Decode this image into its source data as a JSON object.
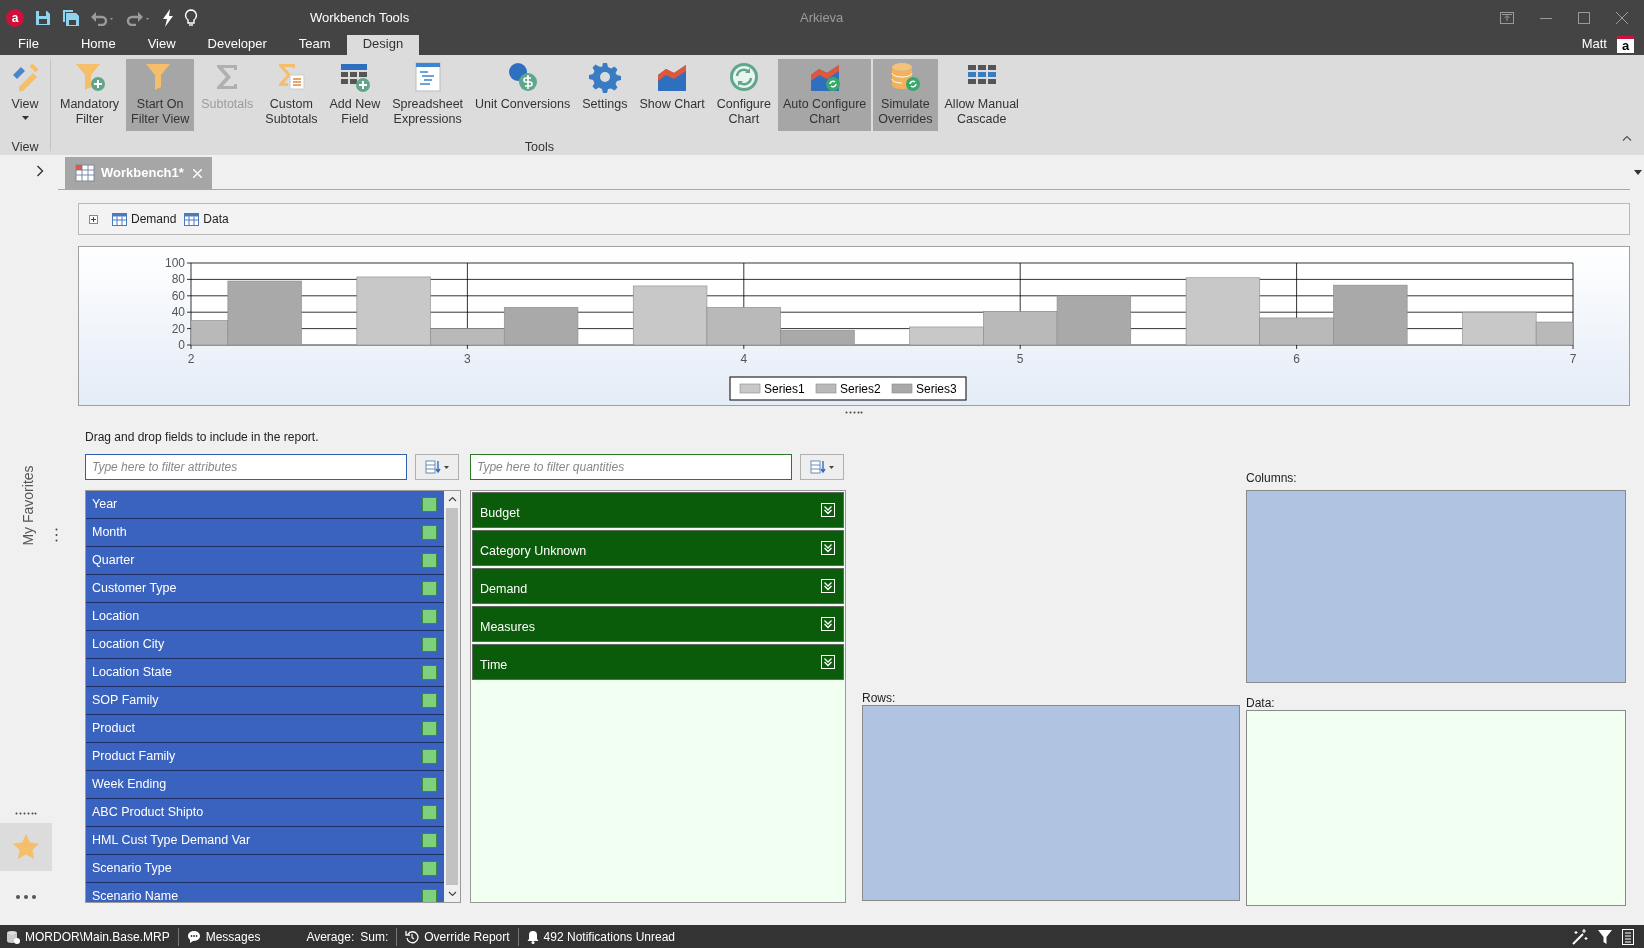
{
  "app": {
    "logo": "a",
    "title": "Workbench Tools",
    "name": "Arkieva"
  },
  "menu_tabs": [
    {
      "label": "File",
      "selected": false
    },
    {
      "label": "Home",
      "selected": false
    },
    {
      "label": "View",
      "selected": false
    },
    {
      "label": "Developer",
      "selected": false
    },
    {
      "label": "Team",
      "selected": false
    },
    {
      "label": "Design",
      "selected": true
    }
  ],
  "user": {
    "name": "Matt",
    "avatar": "a"
  },
  "ribbon": {
    "groups": [
      {
        "label": "View",
        "buttons": [
          {
            "lines": [
              "View"
            ],
            "pressed": false,
            "disabled": false,
            "dropdown": true
          }
        ]
      },
      {
        "label": "Tools",
        "buttons": [
          {
            "lines": [
              "Mandatory",
              "Filter"
            ],
            "pressed": false,
            "disabled": false
          },
          {
            "lines": [
              "Start On",
              "Filter View"
            ],
            "pressed": true,
            "disabled": false
          },
          {
            "lines": [
              "Subtotals"
            ],
            "pressed": false,
            "disabled": true
          },
          {
            "lines": [
              "Custom",
              "Subtotals"
            ],
            "pressed": false,
            "disabled": false
          },
          {
            "lines": [
              "Add New",
              "Field"
            ],
            "pressed": false,
            "disabled": false
          },
          {
            "lines": [
              "Spreadsheet",
              "Expressions"
            ],
            "pressed": false,
            "disabled": false
          },
          {
            "lines": [
              "Unit Conversions"
            ],
            "pressed": false,
            "disabled": false
          },
          {
            "lines": [
              "Settings"
            ],
            "pressed": false,
            "disabled": false
          },
          {
            "lines": [
              "Show Chart"
            ],
            "pressed": false,
            "disabled": false
          },
          {
            "lines": [
              "Configure",
              "Chart"
            ],
            "pressed": false,
            "disabled": false
          },
          {
            "lines": [
              "Auto Configure",
              "Chart"
            ],
            "pressed": true,
            "disabled": false
          },
          {
            "lines": [
              "Simulate",
              "Overrides"
            ],
            "pressed": true,
            "disabled": false
          },
          {
            "lines": [
              "Allow Manual",
              "Cascade"
            ],
            "pressed": false,
            "disabled": false
          }
        ]
      }
    ]
  },
  "doc_tabs": [
    {
      "label": "Workbench1*",
      "selected": true
    }
  ],
  "sidebar": {
    "label": "My Favorites"
  },
  "breadcrumb": [
    "Demand",
    "Data"
  ],
  "chart": {
    "chart_data": {
      "type": "bar",
      "x": [
        2,
        3,
        4,
        5,
        6,
        7
      ],
      "xlim": [
        2,
        7
      ],
      "ylim": [
        0,
        100
      ],
      "xticks": [
        2,
        3,
        4,
        5,
        6,
        7
      ],
      "yticks": [
        0,
        20,
        40,
        60,
        80,
        100
      ],
      "grid": true,
      "legend": true,
      "series": [
        {
          "name": "Series1",
          "color": "#c8c8c8",
          "values": [
            null,
            83,
            72,
            22,
            82,
            40
          ]
        },
        {
          "name": "Series2",
          "color": "#b9b9b9",
          "values": [
            30,
            20,
            46,
            41,
            33,
            28
          ]
        },
        {
          "name": "Series3",
          "color": "#a9a9a9",
          "values": [
            78,
            46,
            18,
            60,
            73,
            null
          ]
        }
      ]
    }
  },
  "instructions": "Drag and drop fields to include in the report.",
  "attribute_filter": {
    "placeholder": "Type here to filter attributes"
  },
  "quantity_filter": {
    "placeholder": "Type here to filter quantities"
  },
  "attributes": [
    "Year",
    "Month",
    "Quarter",
    "Customer Type",
    "Location",
    "Location City",
    "Location State",
    "SOP Family",
    "Product",
    "Product Family",
    "Week Ending",
    "ABC Product Shipto",
    "HML Cust Type Demand Var",
    "Scenario Type",
    "Scenario Name"
  ],
  "quantities": [
    "Budget",
    "Category Unknown",
    "Demand",
    "Measures",
    "Time"
  ],
  "zones": {
    "columns": "Columns:",
    "rows": "Rows:",
    "data": "Data:"
  },
  "status_bar": {
    "database": "MORDOR\\Main.Base.MRP",
    "messages": "Messages",
    "average": "Average:",
    "sum": "Sum:",
    "report": "Override Report",
    "notifications": "492 Notifications Unread"
  }
}
